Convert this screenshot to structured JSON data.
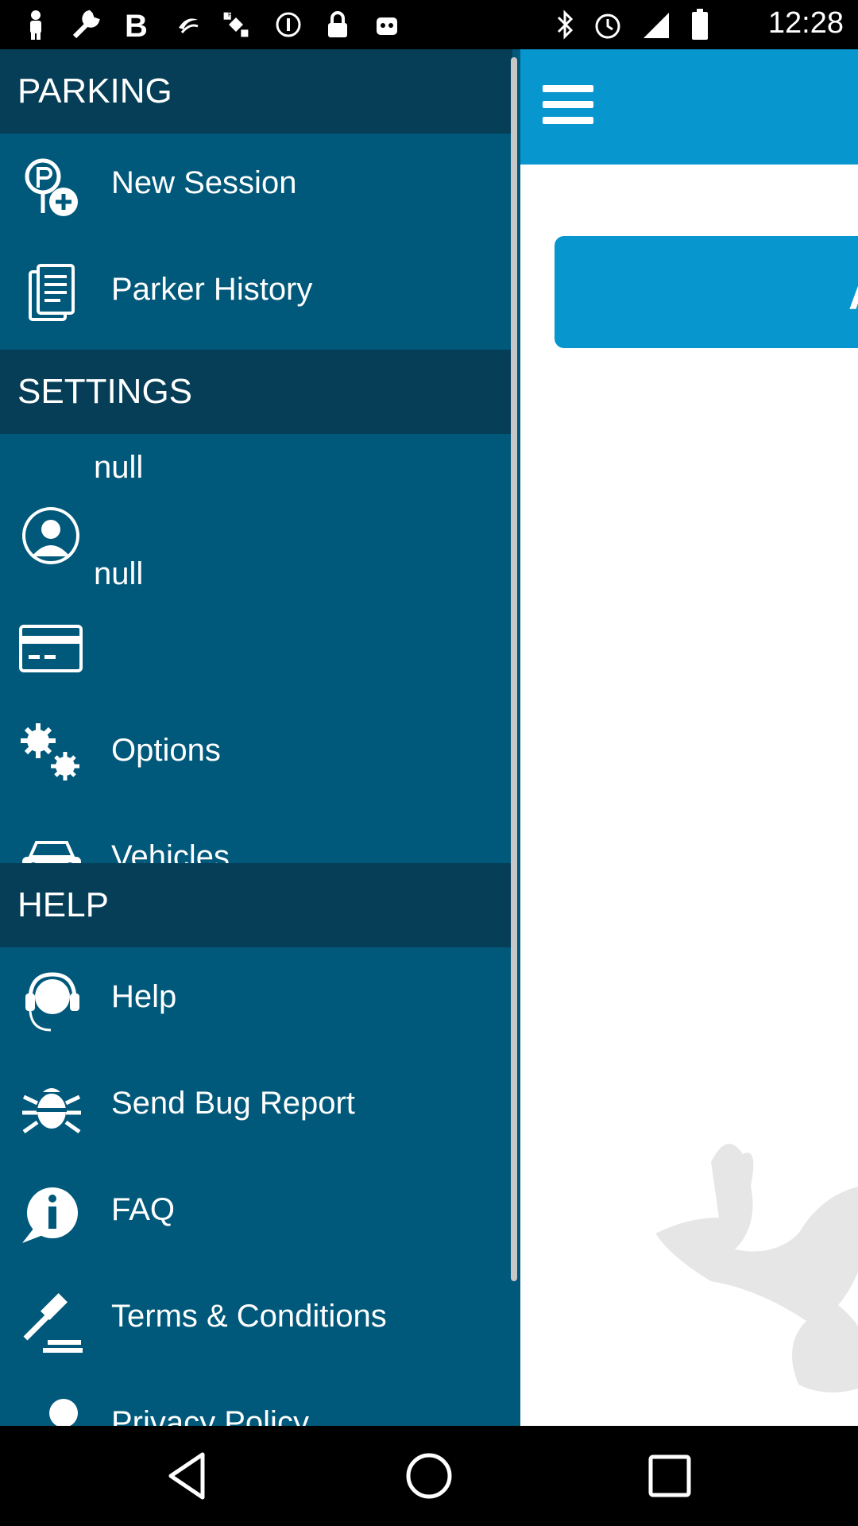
{
  "status_bar": {
    "time": "12:28",
    "left_icons": [
      "person-icon",
      "wrench-icon",
      "bold-b-icon",
      "swoosh-icon",
      "fake-gps-icon",
      "info-circle-icon",
      "lock-icon",
      "android-icon"
    ],
    "right_icons": [
      "bluetooth-icon",
      "alarm-icon",
      "signal-icon",
      "battery-icon"
    ]
  },
  "drawer": {
    "sections": [
      {
        "header": "PARKING",
        "items": [
          {
            "label": "New Session",
            "icon": "parking-add-icon"
          },
          {
            "label": "Parker History",
            "icon": "document-icon"
          }
        ]
      },
      {
        "header": "SETTINGS",
        "items": [
          {
            "label": "null",
            "icon": "user-icon"
          },
          {
            "label": "null",
            "icon": "credit-card-icon"
          },
          {
            "label": "Options",
            "icon": "gears-icon"
          },
          {
            "label": "Vehicles",
            "icon": "car-icon"
          }
        ]
      },
      {
        "header": "HELP",
        "items": [
          {
            "label": "Help",
            "icon": "headset-icon"
          },
          {
            "label": "Send Bug Report",
            "icon": "bug-icon"
          },
          {
            "label": "FAQ",
            "icon": "info-bubble-icon"
          },
          {
            "label": "Terms & Conditions",
            "icon": "gavel-icon"
          },
          {
            "label": "Privacy Policy",
            "icon": "lock-person-icon"
          }
        ]
      }
    ]
  },
  "content": {
    "button_label": "A"
  },
  "colors": {
    "drawer_bg": "#00587a",
    "section_header_bg": "#063e58",
    "accent": "#0896cf"
  }
}
